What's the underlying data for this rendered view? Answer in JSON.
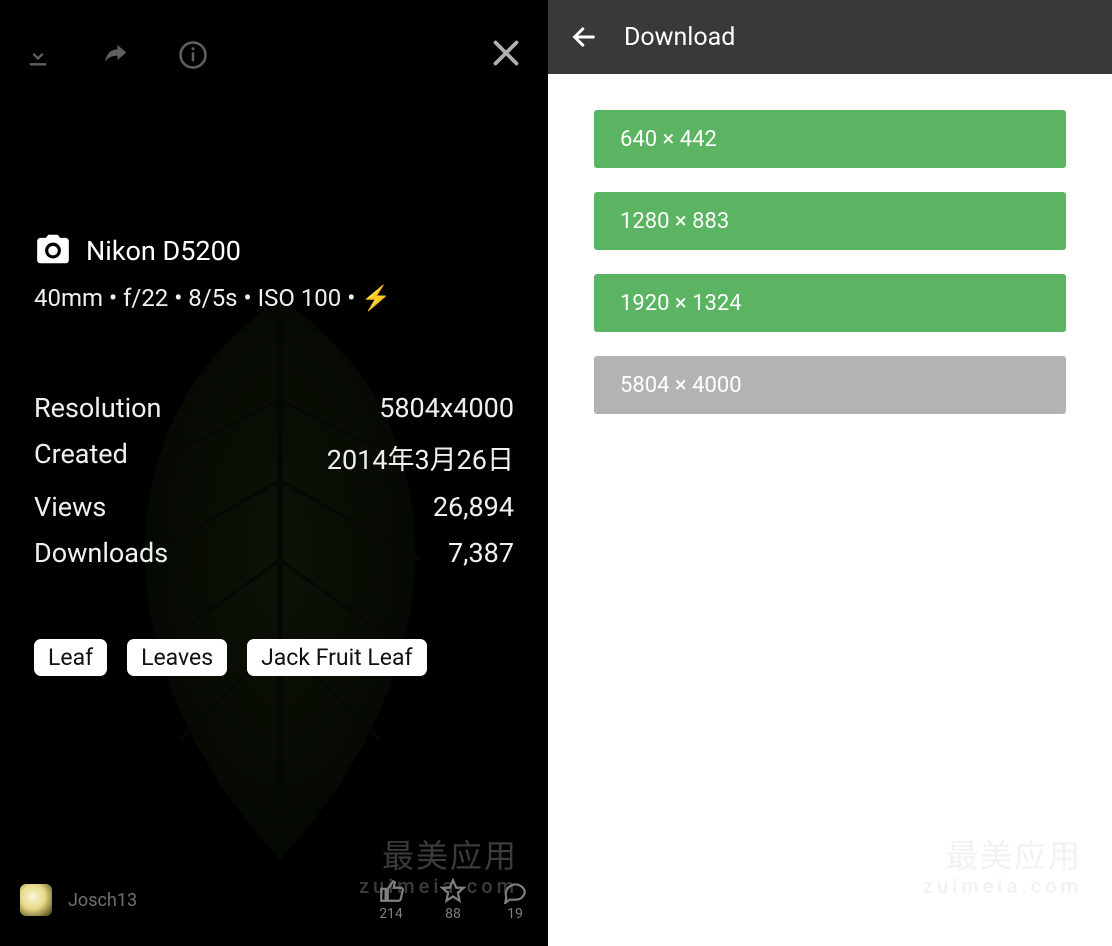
{
  "left": {
    "camera_model": "Nikon D5200",
    "exif_line": "40mm • f/22 • 8/5s • ISO 100 • ⚡",
    "stats": {
      "resolution_label": "Resolution",
      "resolution_value": "5804x4000",
      "created_label": "Created",
      "created_value": "2014年3月26日",
      "views_label": "Views",
      "views_value": "26,894",
      "downloads_label": "Downloads",
      "downloads_value": "7,387"
    },
    "tags": [
      "Leaf",
      "Leaves",
      "Jack Fruit Leaf"
    ],
    "username": "Josch13",
    "metrics": {
      "likes": "214",
      "favorites": "88",
      "comments": "19"
    },
    "watermark_line1": "最美应用",
    "watermark_line2": "zuimeia.com"
  },
  "right": {
    "title": "Download",
    "options": [
      {
        "label": "640 × 442",
        "enabled": true
      },
      {
        "label": "1280 × 883",
        "enabled": true
      },
      {
        "label": "1920 × 1324",
        "enabled": true
      },
      {
        "label": "5804 × 4000",
        "enabled": false
      }
    ],
    "watermark_line1": "最美应用",
    "watermark_line2": "zuimeia.com"
  }
}
